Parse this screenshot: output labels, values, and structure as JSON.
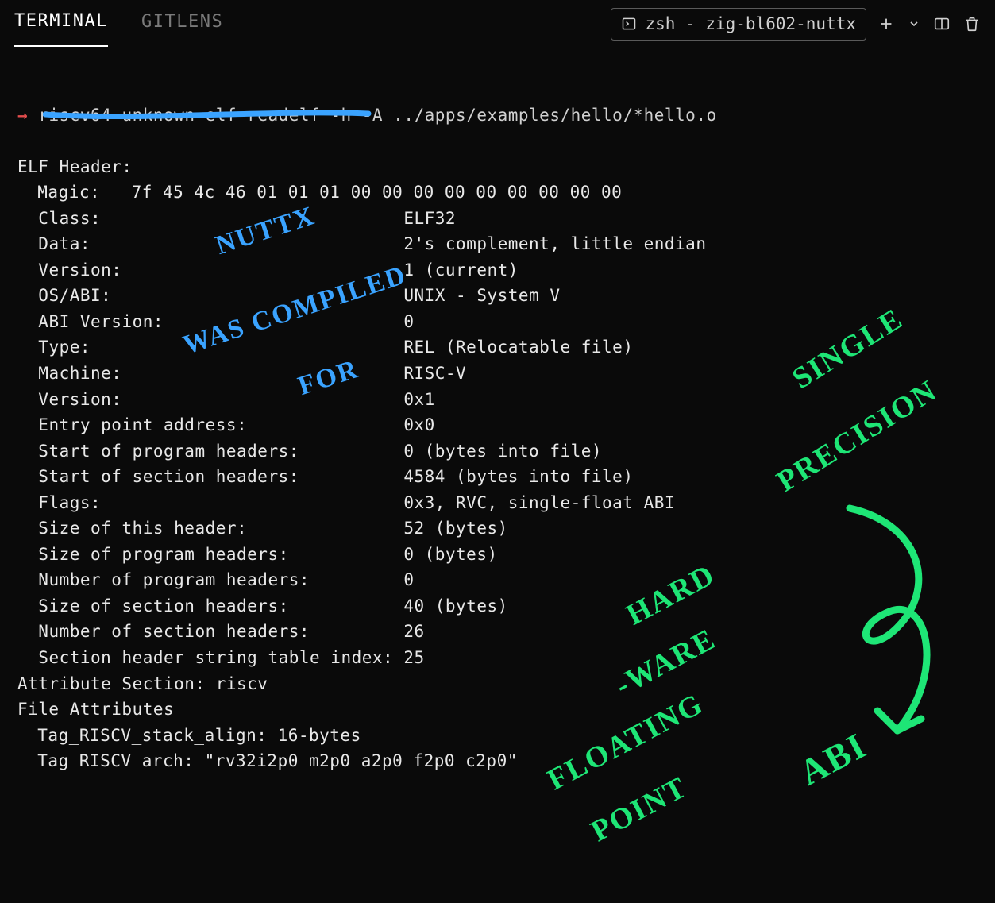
{
  "tabs": {
    "terminal": "TERMINAL",
    "gitlens": "GITLENS"
  },
  "shell": {
    "icon": "terminal-box-icon",
    "label": "zsh - zig-bl602-nuttx"
  },
  "prompt": {
    "arrow": "→",
    "command": "riscv64-unknown-elf-readelf -h -A ../apps/examples/hello/*hello.o"
  },
  "elf": {
    "header_title": "ELF Header:",
    "magic_label": "Magic:",
    "magic_value": "7f 45 4c 46 01 01 01 00 00 00 00 00 00 00 00 00",
    "rows": [
      {
        "k": "Class:",
        "v": "ELF32"
      },
      {
        "k": "Data:",
        "v": "2's complement, little endian"
      },
      {
        "k": "Version:",
        "v": "1 (current)"
      },
      {
        "k": "OS/ABI:",
        "v": "UNIX - System V"
      },
      {
        "k": "ABI Version:",
        "v": "0"
      },
      {
        "k": "Type:",
        "v": "REL (Relocatable file)"
      },
      {
        "k": "Machine:",
        "v": "RISC-V"
      },
      {
        "k": "Version:",
        "v": "0x1"
      },
      {
        "k": "Entry point address:",
        "v": "0x0"
      },
      {
        "k": "Start of program headers:",
        "v": "0 (bytes into file)"
      },
      {
        "k": "Start of section headers:",
        "v": "4584 (bytes into file)"
      },
      {
        "k": "Flags:",
        "v": "0x3, RVC, single-float ABI"
      },
      {
        "k": "Size of this header:",
        "v": "52 (bytes)"
      },
      {
        "k": "Size of program headers:",
        "v": "0 (bytes)"
      },
      {
        "k": "Number of program headers:",
        "v": "0"
      },
      {
        "k": "Size of section headers:",
        "v": "40 (bytes)"
      },
      {
        "k": "Number of section headers:",
        "v": "26"
      },
      {
        "k": "Section header string table index:",
        "v": "25"
      }
    ],
    "attr_section": "Attribute Section: riscv",
    "file_attr": "File Attributes",
    "tag_stack": "Tag_RISCV_stack_align: 16-bytes",
    "tag_arch": "Tag_RISCV_arch: \"rv32i2p0_m2p0_a2p0_f2p0_c2p0\""
  },
  "annotations": {
    "blue1": "NUTTX",
    "blue2": "WAS COMPILED",
    "blue3": "FOR",
    "green1": "SINGLE",
    "green2": "PRECISION",
    "green3": "HARD",
    "green4": "-WARE",
    "green5": "FLOATING",
    "green6": "POINT",
    "green7": "ABI"
  }
}
